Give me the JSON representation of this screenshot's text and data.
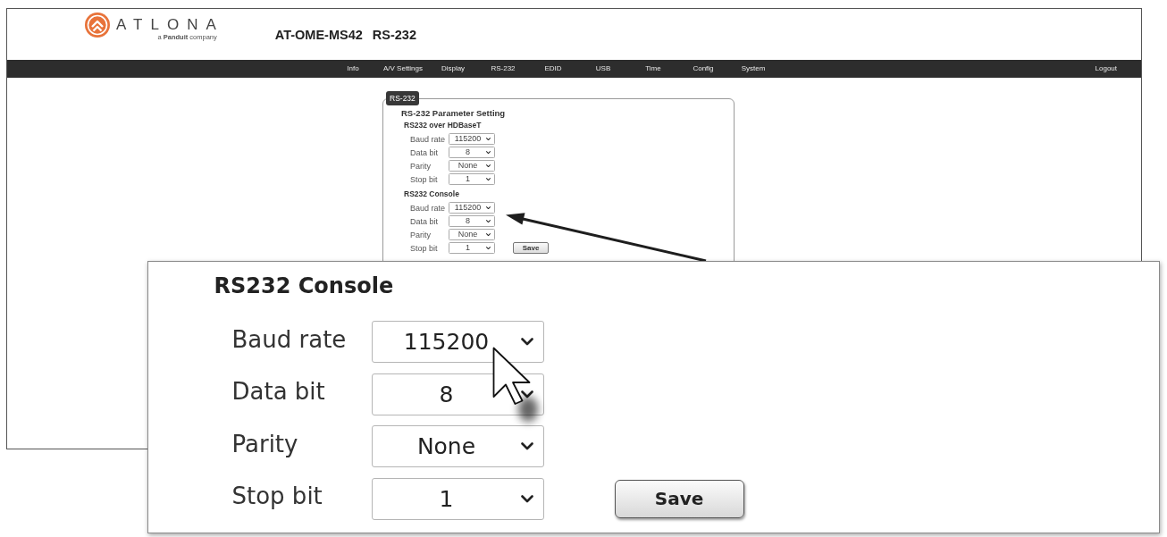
{
  "header": {
    "logo": {
      "wordmark": "ATLONA",
      "tagline": "a **Panduit** company"
    },
    "model": "AT-OME-MS42",
    "page_title": "RS-232"
  },
  "nav": {
    "items": [
      "Info",
      "A/V Settings",
      "Display",
      "RS-232",
      "EDID",
      "USB",
      "Time",
      "Config",
      "System"
    ],
    "logout": "Logout"
  },
  "panel": {
    "legend": "RS-232",
    "heading": "RS-232 Parameter Setting",
    "sections": [
      {
        "title": "RS232 over HDBaseT",
        "fields": [
          {
            "label": "Baud rate",
            "value": "115200"
          },
          {
            "label": "Data bit",
            "value": "8"
          },
          {
            "label": "Parity",
            "value": "None"
          },
          {
            "label": "Stop bit",
            "value": "1"
          }
        ]
      },
      {
        "title": "RS232 Console",
        "fields": [
          {
            "label": "Baud rate",
            "value": "115200"
          },
          {
            "label": "Data bit",
            "value": "8"
          },
          {
            "label": "Parity",
            "value": "None"
          },
          {
            "label": "Stop bit",
            "value": "1"
          }
        ]
      }
    ],
    "save": "Save"
  },
  "inset": {
    "title": "RS232 Console",
    "fields": [
      {
        "label": "Baud rate",
        "value": "115200"
      },
      {
        "label": "Data bit",
        "value": "8"
      },
      {
        "label": "Parity",
        "value": "None"
      },
      {
        "label": "Stop bit",
        "value": "1"
      }
    ],
    "save": "Save"
  }
}
